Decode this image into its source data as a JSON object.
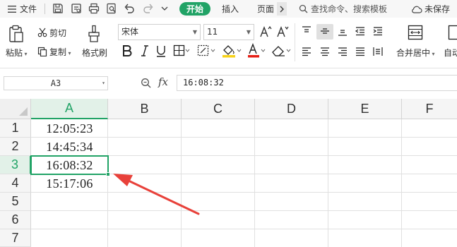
{
  "topbar": {
    "file_menu": "文件",
    "start_tab": "开始",
    "insert_tab": "插入",
    "page_tab": "页面",
    "search_placeholder": "查找命令、搜索模板",
    "unsaved_status": "未保存"
  },
  "ribbon": {
    "paste_label": "粘贴",
    "cut_label": "剪切",
    "copy_label": "复制",
    "format_painter_label": "格式刷",
    "font_name": "宋体",
    "font_size": "11",
    "merge_center_label": "合并居中",
    "auto_label": "自动"
  },
  "formula_bar": {
    "cell_ref": "A3",
    "fx_label": "fx",
    "formula_value": "16:08:32"
  },
  "sheet": {
    "columns": [
      "A",
      "B",
      "C",
      "D",
      "E",
      "F"
    ],
    "rows": [
      "1",
      "2",
      "3",
      "4",
      "5",
      "6",
      "7"
    ],
    "cells": [
      "12:05:23",
      "14:45:34",
      "16:08:32",
      "15:17:06"
    ],
    "active_cell": "A3"
  },
  "colors": {
    "accent": "#21a366",
    "arrow": "#e8413a"
  }
}
